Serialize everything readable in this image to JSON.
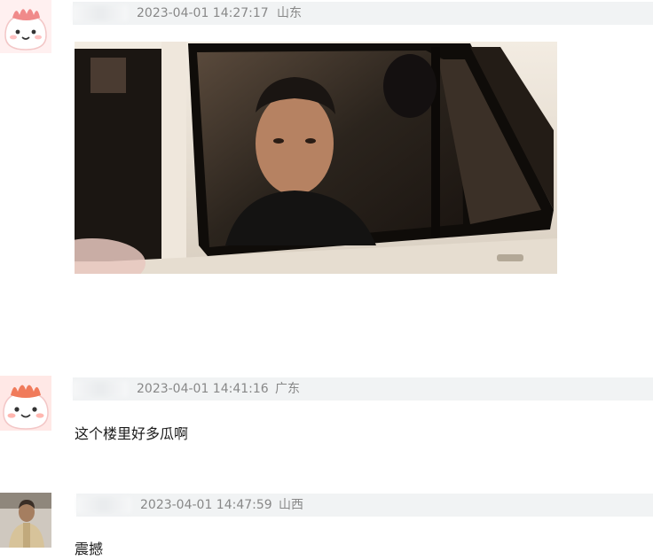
{
  "comments": [
    {
      "avatar": "cartoon-dumpling-avatar",
      "timestamp": "2023-04-01 14:27:17",
      "location": "山东",
      "text": ""
    },
    {
      "avatar": "cartoon-dumpling-avatar",
      "timestamp": "2023-04-01 14:41:16",
      "location": "广东",
      "text": "这个楼里好多瓜啊"
    },
    {
      "avatar": "person-photo-avatar",
      "timestamp": "2023-04-01 14:47:59",
      "location": "山西",
      "text": "震撼"
    }
  ],
  "colors": {
    "meta_bar": "#f1f3f4",
    "meta_text": "#888888",
    "avatar_bg": "#ffe3e3",
    "avatar_crest": "#f08a8a"
  }
}
